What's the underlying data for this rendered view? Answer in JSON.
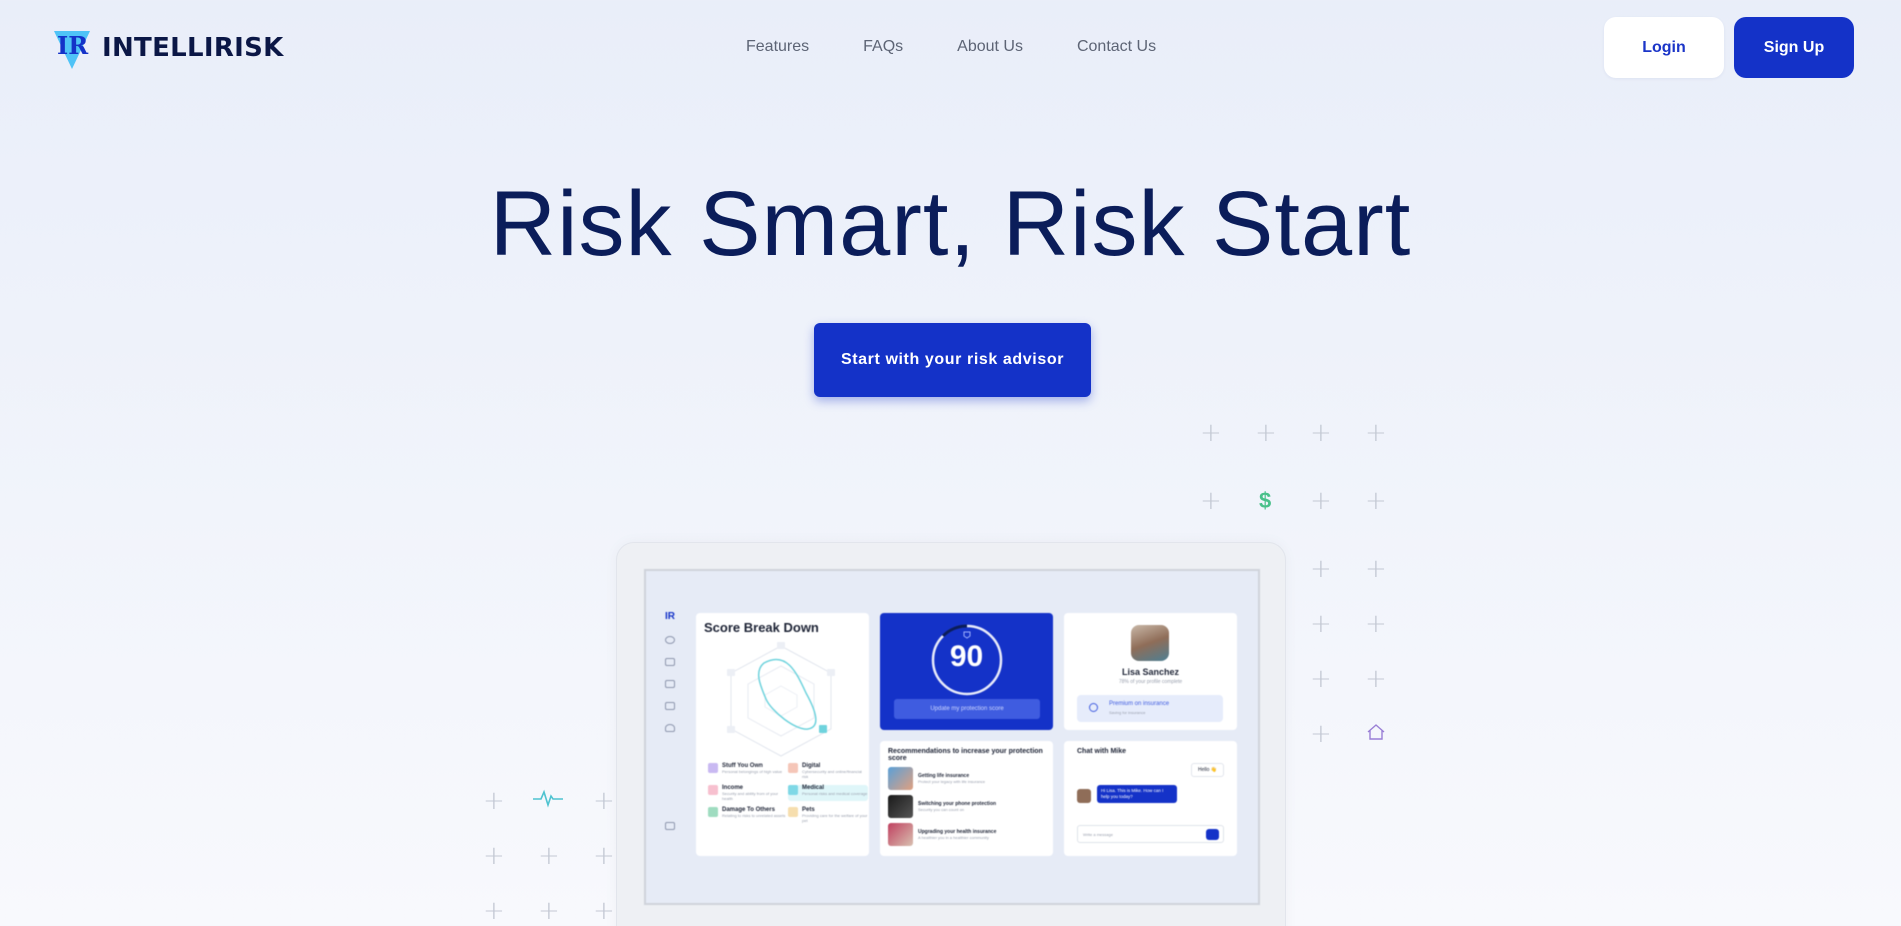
{
  "brand": {
    "name": "INTELLIRISK",
    "logo_letters": "IR",
    "primary_color": "#1432c8",
    "dark_text_color": "#0b1d5a"
  },
  "nav": {
    "items": [
      "Features",
      "FAQs",
      "About Us",
      "Contact Us"
    ]
  },
  "header": {
    "login_label": "Login",
    "signup_label": "Sign Up"
  },
  "hero": {
    "title": "Risk Smart, Risk Start",
    "cta_label": "Start with your risk advisor"
  },
  "decorations": {
    "icons": [
      "plus-icon",
      "dollar-icon",
      "house-icon",
      "heartbeat-icon"
    ],
    "dollar_symbol": "$"
  },
  "dashboard_preview": {
    "score_card": {
      "title": "Score Break Down",
      "legend": [
        {
          "label": "Stuff You Own",
          "sub": "Personal belongings of high value",
          "color": "#c9b9f2"
        },
        {
          "label": "Digital",
          "sub": "Cybersecurity and online/financial risk",
          "color": "#f5c6b8"
        },
        {
          "label": "Income",
          "sub": "Security and ability from of your health",
          "color": "#f7c0cf"
        },
        {
          "label": "Medical",
          "sub": "Personal risks and medical coverage",
          "color": "#7fd8e6"
        },
        {
          "label": "Damage To Others",
          "sub": "Relating to risks to unrelated assets",
          "color": "#9fdcc0"
        },
        {
          "label": "Pets",
          "sub": "Providing care for the welfare of your pet",
          "color": "#f6deae"
        }
      ]
    },
    "protection_score": {
      "value": "90",
      "button_label": "Update my protection score"
    },
    "profile": {
      "name": "Lisa Sanchez",
      "completion": "78% of your profile complete",
      "premium_title": "Premium on insurance",
      "premium_sub": "Saving for insurance"
    },
    "recommendations": {
      "title": "Recommendations to increase your protection score",
      "items": [
        {
          "label": "Getting life insurance",
          "sub": "Protect your legacy with life insurance"
        },
        {
          "label": "Switching your phone protection",
          "sub": "Security you can count on"
        },
        {
          "label": "Upgrading your health insurance",
          "sub": "A healthier you in a healthier community"
        }
      ]
    },
    "chat": {
      "title": "Chat with Mike",
      "greeting": "Hello 👋",
      "message": "Hi Lisa. This is Mike. How can I help you today?",
      "input_placeholder": "Write a message"
    }
  }
}
